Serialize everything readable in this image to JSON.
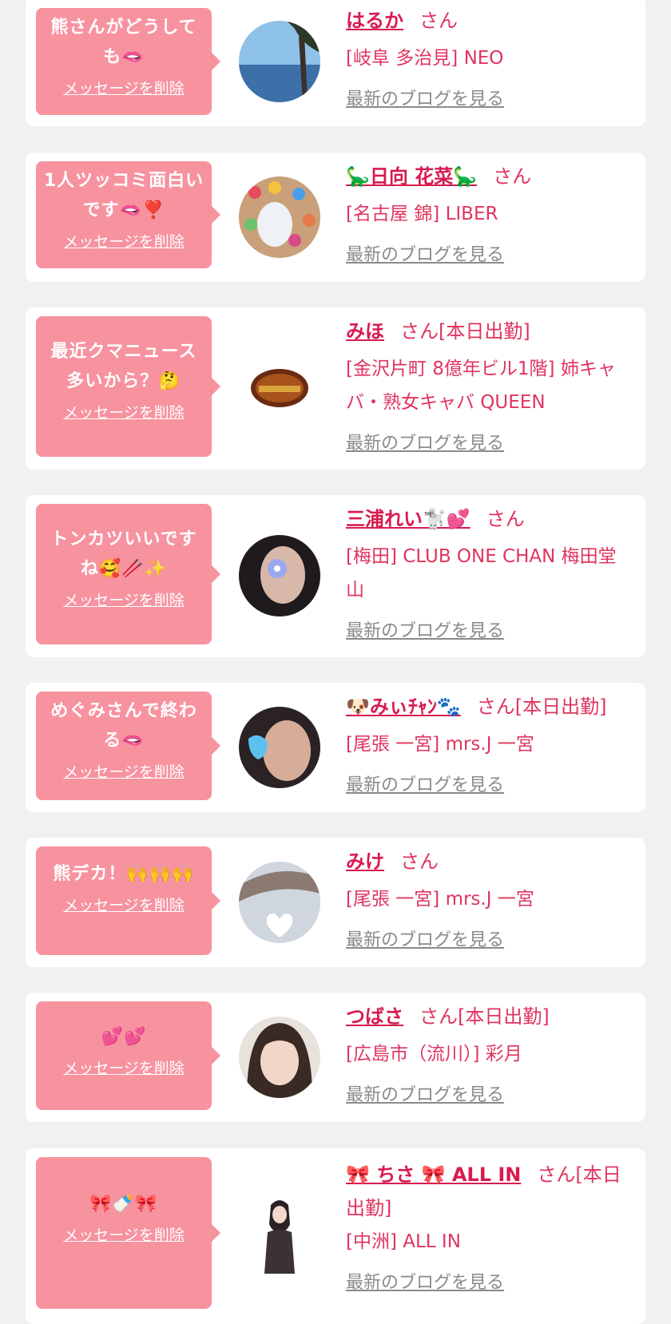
{
  "delete_label": "メッセージを削除",
  "blog_label": "最新のブログを見る",
  "colors": {
    "bubble": "#f7929f",
    "name": "#d81b4f",
    "text": "#e0345e",
    "link": "#8a8a8a"
  },
  "cards": [
    {
      "message": "熊さんがどうしても🫦",
      "name": "はるか",
      "suffix": "さん",
      "shop": "[岐阜 多治見] NEO",
      "avatar": "avatar-photo"
    },
    {
      "message": "1人ツッコミ面白いです🫦❣️",
      "name": "🦕日向 花菜🦕",
      "suffix": "さん",
      "shop": "[名古屋 錦] LIBER",
      "avatar": "avatar-photo"
    },
    {
      "message": "最近クマニュース多いから？🤔",
      "name": "みほ",
      "suffix": "さん[本日出勤]",
      "shop": "[金沢片町 8億年ビル1階] 姉キャバ・熟女キャバ QUEEN",
      "avatar": "avatar-photo"
    },
    {
      "message": "トンカツいいですね🥰🥢✨",
      "name": "三浦れい🐩💕",
      "suffix": "さん",
      "shop": "[梅田] CLUB ONE CHAN 梅田堂山",
      "avatar": "avatar-photo"
    },
    {
      "message": "めぐみさんで終わる🫦",
      "name": "🐶みぃﾁｬﾝ🐾",
      "suffix": "さん[本日出勤]",
      "shop": "[尾張 一宮] mrs.J 一宮",
      "avatar": "avatar-photo"
    },
    {
      "message": "熊デカ！🙌🙌🙌",
      "name": "みけ",
      "suffix": "さん",
      "shop": "[尾張 一宮] mrs.J 一宮",
      "avatar": "avatar-photo"
    },
    {
      "message": "💕💕",
      "name": "つばさ",
      "suffix": "さん[本日出勤]",
      "shop": "[広島市（流川）] 彩月",
      "avatar": "avatar-photo"
    },
    {
      "message": "🎀🍼🎀",
      "name": "🎀 ちさ 🎀 ALL IN",
      "suffix": "さん[本日出勤]",
      "shop": "[中洲] ALL IN",
      "avatar": "avatar-photo"
    }
  ]
}
